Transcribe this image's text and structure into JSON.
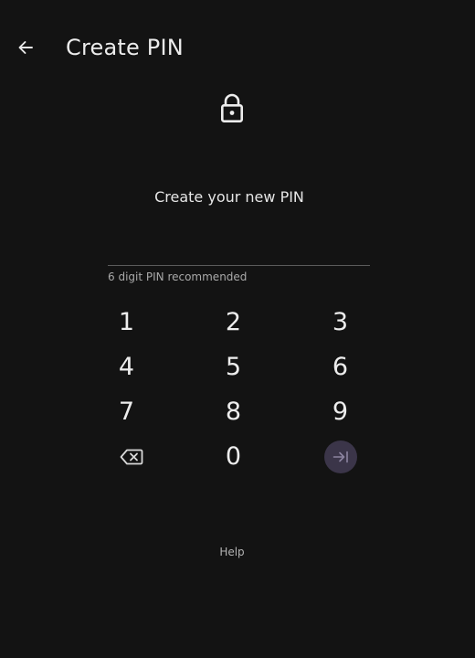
{
  "header": {
    "title": "Create PIN",
    "back_icon": "arrow-left-icon"
  },
  "lock_icon": "lock-icon",
  "prompt": "Create your new PIN",
  "pin_input": {
    "value": "",
    "placeholder": ""
  },
  "hint": "6 digit PIN recommended",
  "keypad": {
    "digits": [
      "1",
      "2",
      "3",
      "4",
      "5",
      "6",
      "7",
      "8",
      "9",
      "0"
    ],
    "backspace_icon": "backspace-icon",
    "submit_icon": "arrow-to-right-icon"
  },
  "help_label": "Help",
  "colors": {
    "background": "#131313",
    "text": "#ececec",
    "submit_button": "#3b3549",
    "submit_icon": "#8c84a0",
    "underline": "#5b5b5b"
  }
}
